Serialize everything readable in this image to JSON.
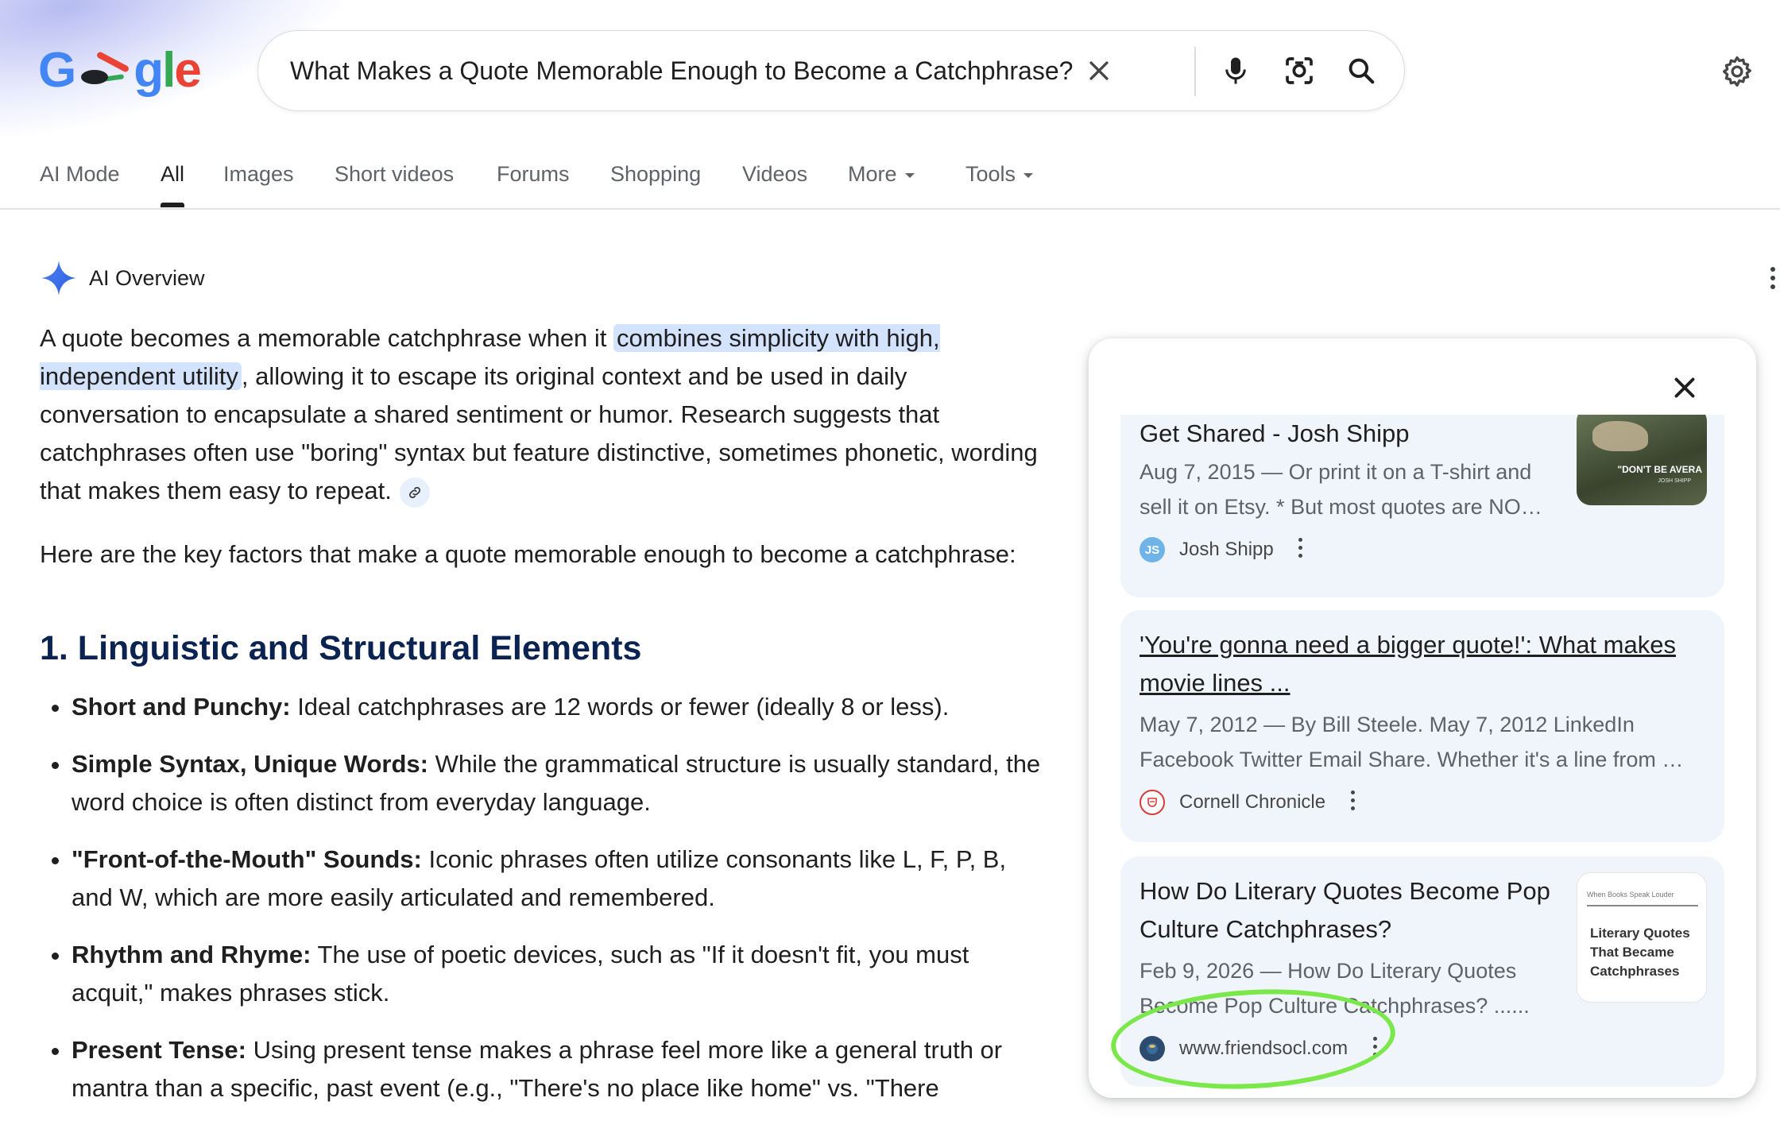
{
  "search": {
    "query": "What Makes a Quote Memorable Enough to Become a Catchphrase?"
  },
  "tabs": [
    {
      "label": "AI Mode"
    },
    {
      "label": "All"
    },
    {
      "label": "Images"
    },
    {
      "label": "Short videos"
    },
    {
      "label": "Forums"
    },
    {
      "label": "Shopping"
    },
    {
      "label": "Videos"
    },
    {
      "label": "More"
    },
    {
      "label": "Tools"
    }
  ],
  "active_tab": "All",
  "ai_overview": {
    "title": "AI Overview",
    "intro_before": "A quote becomes a memorable catchphrase when it ",
    "intro_highlight": "combines simplicity with high, independent utility",
    "intro_after": ", allowing it to escape its original context and be used in daily conversation to encapsulate a shared sentiment or humor. Research suggests that catchphrases often use \"boring\" syntax but feature distinctive, sometimes phonetic, wording that makes them easy to repeat.",
    "lead_in": "Here are the key factors that make a quote memorable enough to become a catchphrase:",
    "section_heading": "1. Linguistic and Structural Elements",
    "factors": [
      {
        "term": "Short and Punchy:",
        "text": " Ideal catchphrases are 12 words or fewer (ideally 8 or less)."
      },
      {
        "term": "Simple Syntax, Unique Words:",
        "text": " While the grammatical structure is usually standard, the word choice is often distinct from everyday language."
      },
      {
        "term": "\"Front-of-the-Mouth\" Sounds:",
        "text": " Iconic phrases often utilize consonants like L, F, P, B, and W, which are more easily articulated and remembered."
      },
      {
        "term": "Rhythm and Rhyme:",
        "text": " The use of poetic devices, such as \"If it doesn't fit, you must acquit,\" makes phrases stick."
      },
      {
        "term": "Present Tense:",
        "text": " Using present tense makes a phrase feel more like a general truth or mantra than a specific, past event (e.g., \"There's no place like home\" vs. \"There"
      }
    ]
  },
  "sources": [
    {
      "title": "Get Shared - Josh Shipp",
      "snippet": "Aug 7, 2015 — Or print it on a T-shirt and sell it on Etsy. * But most quotes are NO…",
      "site": "Josh Shipp",
      "favicon_text": "JS",
      "thumb_text": "\"DON'T BE AVERA",
      "thumb_subtext": "JOSH SHIPP"
    },
    {
      "title": "'You're gonna need a bigger quote!': What makes movie lines ...",
      "snippet": "May 7, 2012 — By Bill Steele. May 7, 2012 LinkedIn Facebook Twitter Email Share. Whether it's a line from …",
      "site": "Cornell Chronicle"
    },
    {
      "title": "How Do Literary Quotes Become Pop Culture Catchphrases?",
      "snippet": "Feb 9, 2026 — How Do Literary Quotes Become Pop Culture Catchphrases? ......",
      "site": "www.friendsocl.com",
      "thumb_small": "When Books Speak Louder",
      "thumb_title": "Literary Quotes That Became Catchphrases"
    }
  ],
  "icons": {
    "clear": "close-icon",
    "voice": "mic-icon",
    "lens": "camera-lens-icon",
    "search": "search-icon",
    "settings": "gear-icon",
    "ai": "sparkle-icon"
  },
  "colors": {
    "highlight": "#d3e3fd",
    "heading": "#0b2350",
    "card_bg": "#f0f4fb",
    "annotation_ring": "#7ae84a"
  }
}
